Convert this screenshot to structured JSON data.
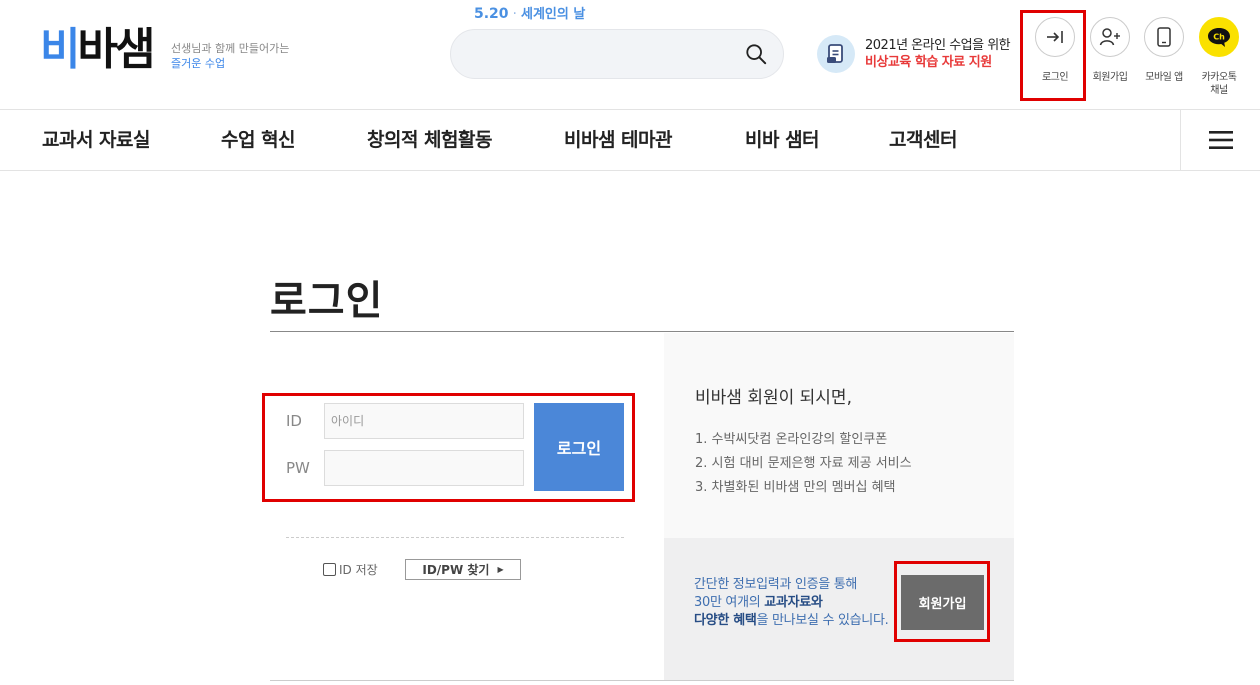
{
  "header": {
    "logo_text_left": "비",
    "logo_text_right": "바샘",
    "slogan_line1": "선생님과 함께 만들어가는",
    "slogan_line2": "즐거운 수업",
    "event_date": "5.20",
    "event_sep": "·",
    "event_name": "세계인의 날",
    "search_placeholder": "",
    "promo_line1": "2021년 온라인 수업을 위한",
    "promo_line2": "비상교육 학습 자료 지원",
    "util": {
      "login": "로그인",
      "join": "회원가입",
      "mobile": "모바일 앱",
      "kakao_line1": "카카오톡",
      "kakao_line2": "채널",
      "kakao_badge": "Ch"
    }
  },
  "nav": {
    "items": [
      "교과서 자료실",
      "수업 혁신",
      "창의적 체험활동",
      "비바샘 테마관",
      "비바 샘터",
      "고객센터"
    ]
  },
  "login": {
    "title": "로그인",
    "id_label": "ID",
    "id_placeholder": "아이디",
    "pw_label": "PW",
    "pw_placeholder": "",
    "submit": "로그인",
    "save_id": "ID 저장",
    "find": "ID/PW 찾기",
    "find_arrow": "▶"
  },
  "benefits": {
    "title": "비바샘 회원이 되시면,",
    "items": [
      "1. 수박씨닷컴 온라인강의 할인쿠폰",
      "2. 시험 대비 문제은행 자료 제공 서비스",
      "3. 차별화된 비바샘 만의 멤버십 혜택"
    ]
  },
  "join": {
    "desc_line1": "간단한 정보입력과 인증을 통해",
    "desc_line2_pre": "30만 여개의 ",
    "desc_line2_bold": "교과자료와",
    "desc_line3_bold": "다양한 혜택",
    "desc_line3_post": "을 만나보실 수 있습니다.",
    "button": "회원가입"
  },
  "colors": {
    "accent": "#4b87d8",
    "highlight_red": "#e00000",
    "promo_red": "#e83a3a",
    "kakao_yellow": "#fae100"
  }
}
